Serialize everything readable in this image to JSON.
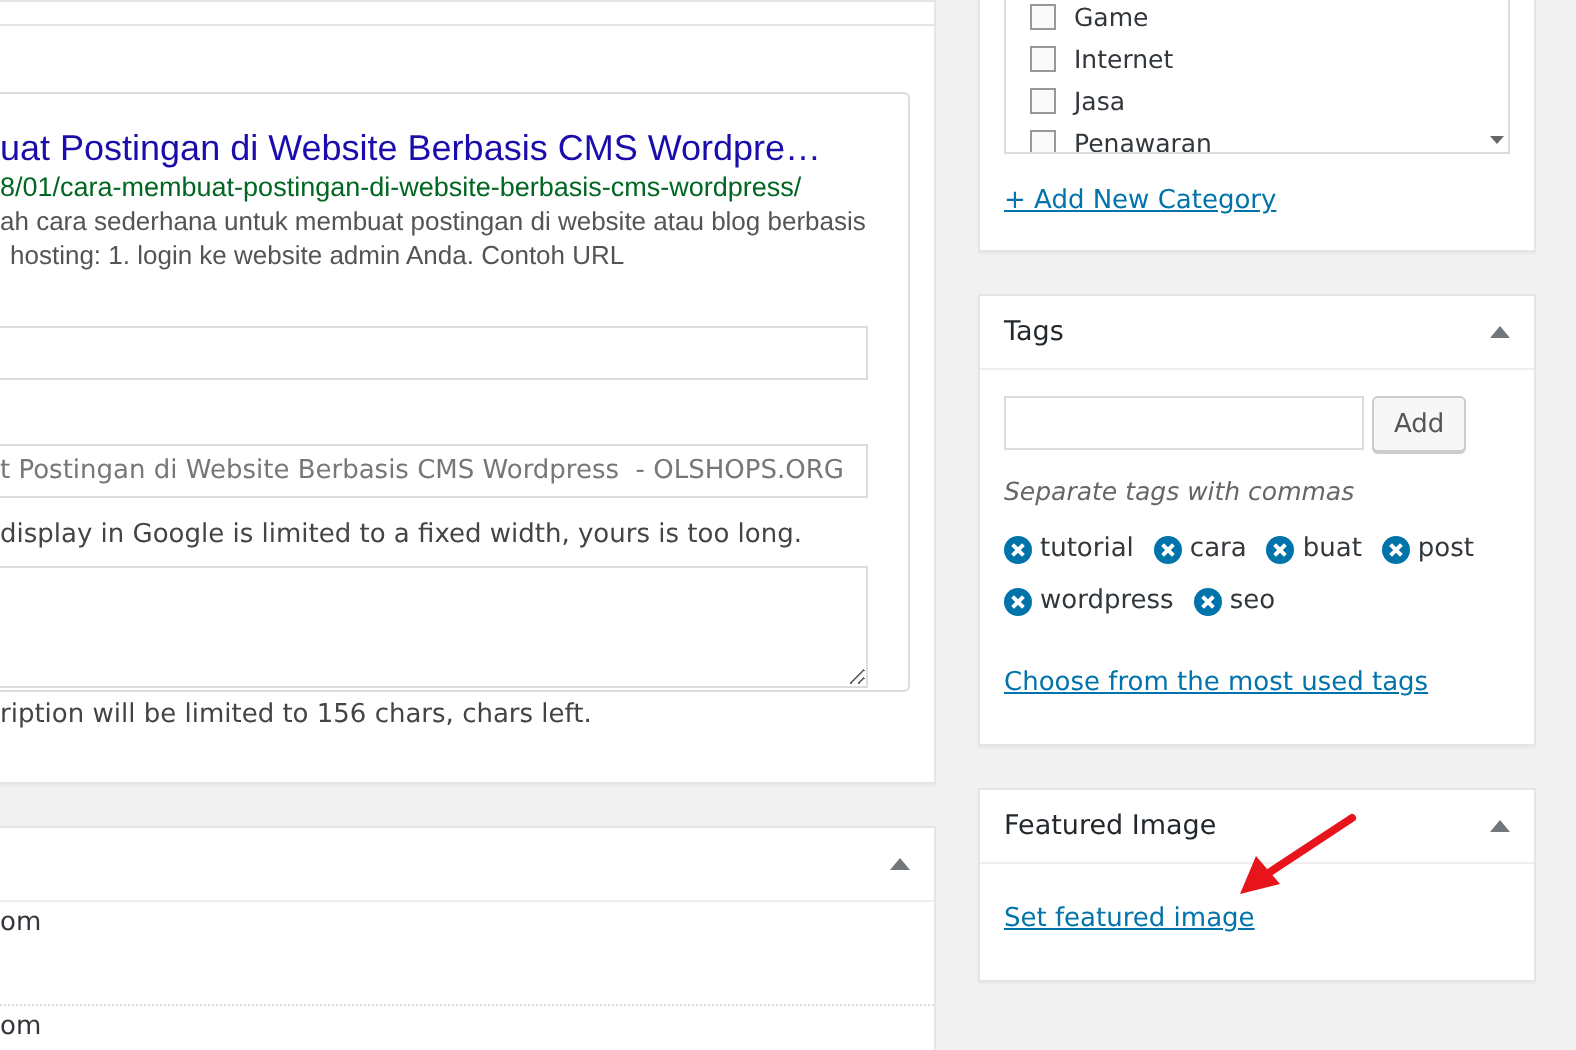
{
  "seo_box": {
    "title": "uat Postingan di Website Berbasis CMS Wordpre…",
    "url": "8/01/cara-membuat-postingan-di-website-berbasis-cms-wordpress/",
    "description_lines": [
      "ah cara sederhana untuk membuat postingan di website atau blog berbasis",
      "hosting: 1. login ke website admin Anda. Contoh URL"
    ],
    "fields": [
      {
        "kind": "input"
      },
      {
        "kind": "input",
        "value": "t Postingan di Website Berbasis CMS Wordpress  - OLSHOPS.ORG"
      },
      {
        "kind": "note",
        "text": "display in Google is limited to a fixed width, yours is too long."
      },
      {
        "kind": "textarea"
      },
      {
        "kind": "note",
        "text": "ription will be limited to 156 chars, chars left."
      }
    ]
  },
  "lower_panel": {
    "rows": [
      "om",
      "om"
    ]
  },
  "categories": {
    "items": [
      {
        "label": "Game",
        "checked": false
      },
      {
        "label": "Internet",
        "checked": false
      },
      {
        "label": "Jasa",
        "checked": false
      },
      {
        "label": "Penawaran",
        "checked": false
      }
    ],
    "add_link": "+ Add New Category"
  },
  "tags": {
    "title": "Tags",
    "add_button": "Add",
    "hint": "Separate tags with commas",
    "tags": [
      "tutorial",
      "cara",
      "buat",
      "post",
      "wordpress",
      "seo"
    ],
    "link": "Choose from the most used tags"
  },
  "featured_image": {
    "title": "Featured Image",
    "link": "Set featured image"
  }
}
